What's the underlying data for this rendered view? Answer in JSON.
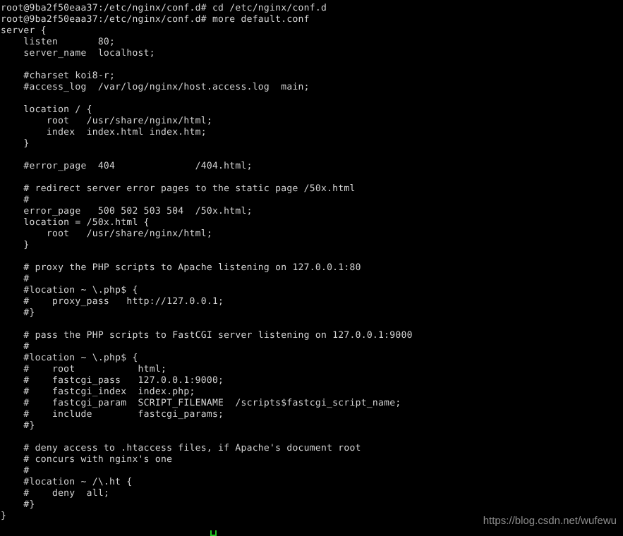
{
  "terminal": {
    "title": "root@9ba2f50eaa37: /etc/nginx/conf.d",
    "colors": {
      "background": "#000000",
      "foreground": "#d6d6d6",
      "cursor": "#22c522",
      "watermark": "#8f8f8f"
    },
    "prompt": "root@9ba2f50eaa37:/etc/nginx/conf.d#",
    "hostname": "9ba2f50eaa37",
    "user": "root",
    "cwd": "/etc/nginx/conf.d",
    "commands": [
      "cd /etc/nginx/conf.d",
      "more default.conf"
    ],
    "lines": [
      "root@9ba2f50eaa37:/etc/nginx/conf.d# cd /etc/nginx/conf.d",
      "root@9ba2f50eaa37:/etc/nginx/conf.d# more default.conf",
      "server {",
      "    listen       80;",
      "    server_name  localhost;",
      "",
      "    #charset koi8-r;",
      "    #access_log  /var/log/nginx/host.access.log  main;",
      "",
      "    location / {",
      "        root   /usr/share/nginx/html;",
      "        index  index.html index.htm;",
      "    }",
      "",
      "    #error_page  404              /404.html;",
      "",
      "    # redirect server error pages to the static page /50x.html",
      "    #",
      "    error_page   500 502 503 504  /50x.html;",
      "    location = /50x.html {",
      "        root   /usr/share/nginx/html;",
      "    }",
      "",
      "    # proxy the PHP scripts to Apache listening on 127.0.0.1:80",
      "    #",
      "    #location ~ \\.php$ {",
      "    #    proxy_pass   http://127.0.0.1;",
      "    #}",
      "",
      "    # pass the PHP scripts to FastCGI server listening on 127.0.0.1:9000",
      "    #",
      "    #location ~ \\.php$ {",
      "    #    root           html;",
      "    #    fastcgi_pass   127.0.0.1:9000;",
      "    #    fastcgi_index  index.php;",
      "    #    fastcgi_param  SCRIPT_FILENAME  /scripts$fastcgi_script_name;",
      "    #    include        fastcgi_params;",
      "    #}",
      "",
      "    # deny access to .htaccess files, if Apache's document root",
      "    # concurs with nginx's one",
      "    #",
      "    #location ~ /\\.ht {",
      "    #    deny  all;",
      "    #}",
      "}"
    ]
  },
  "watermark": {
    "text": "https://blog.csdn.net/wufewu"
  }
}
